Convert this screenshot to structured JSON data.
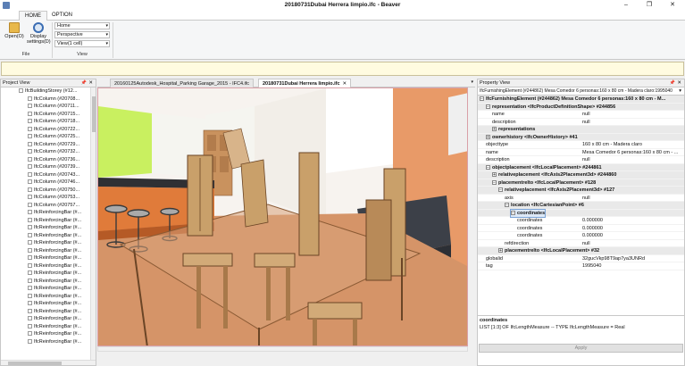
{
  "window": {
    "title": "20180731Dubai Herrera limpio.ifc - Beaver"
  },
  "ribbon": {
    "tabs": [
      "HOME",
      "OPTION"
    ],
    "open_label": "Open(O)",
    "display_label": "Display settings(D)",
    "combos": [
      "Home",
      "Perspective",
      "View(1 cell)"
    ],
    "group_file": "File",
    "group_view": "View"
  },
  "project_view": {
    "title": "Project View",
    "items": [
      "IfcBuildingStorey (#12...",
      "IfcColumn (#20708...",
      "IfcColumn (#20711...",
      "IfcColumn (#20715...",
      "IfcColumn (#20718...",
      "IfcColumn (#20722...",
      "IfcColumn (#20725...",
      "IfcColumn (#20729...",
      "IfcColumn (#20732...",
      "IfcColumn (#20736...",
      "IfcColumn (#20739...",
      "IfcColumn (#20743...",
      "IfcColumn (#20746...",
      "IfcColumn (#20750...",
      "IfcColumn (#20753...",
      "IfcColumn (#20757...",
      "IfcReinforcingBar (#...",
      "IfcReinforcingBar (#...",
      "IfcReinforcingBar (#...",
      "IfcReinforcingBar (#...",
      "IfcReinforcingBar (#...",
      "IfcReinforcingBar (#...",
      "IfcReinforcingBar (#...",
      "IfcReinforcingBar (#...",
      "IfcReinforcingBar (#...",
      "IfcReinforcingBar (#...",
      "IfcReinforcingBar (#...",
      "IfcReinforcingBar (#...",
      "IfcReinforcingBar (#...",
      "IfcReinforcingBar (#...",
      "IfcReinforcingBar (#...",
      "IfcReinforcingBar (#...",
      "IfcReinforcingBar (#...",
      "IfcReinforcingBar (#..."
    ]
  },
  "doc_tabs": [
    {
      "label": "20160125Autodesk_Hospital_Parking Garage_2015 - IFC4.ifc",
      "active": false
    },
    {
      "label": "20180731Dubai Herrera limpio.ifc",
      "active": true
    }
  ],
  "property_view": {
    "title": "Property View",
    "header": "IfcFurnishingElement (#244862) Mesa Comedor 6 personas:160 x 80 cm - Madera claro:1995040",
    "rows": [
      {
        "indent": 0,
        "type": "sect",
        "tog": "⊟",
        "key": "IfcFurnishingElement (#244862) Mesa Comedor 6 personas:160 x 80 cm - M...",
        "value": ""
      },
      {
        "indent": 1,
        "type": "sect",
        "tog": "⊟",
        "key": "representation <IfcProductDefinitionShape> #244856",
        "value": ""
      },
      {
        "indent": 2,
        "type": "row",
        "key": "name",
        "value": "null"
      },
      {
        "indent": 2,
        "type": "row",
        "key": "description",
        "value": "null"
      },
      {
        "indent": 2,
        "type": "sect",
        "tog": "⊞",
        "key": "representations",
        "value": ""
      },
      {
        "indent": 1,
        "type": "sect",
        "tog": "⊞",
        "key": "ownerhistory <IfcOwnerHistory> #41",
        "value": ""
      },
      {
        "indent": 1,
        "type": "row",
        "key": "objecttype",
        "value": "160 x 80 cm - Madera claro"
      },
      {
        "indent": 1,
        "type": "row",
        "key": "name",
        "value": "Mesa Comedor 6 personas:160 x 80 cm - ..."
      },
      {
        "indent": 1,
        "type": "row",
        "key": "description",
        "value": "null"
      },
      {
        "indent": 1,
        "type": "sect",
        "tog": "⊟",
        "key": "objectplacement <IfcLocalPlacement> #244861",
        "value": ""
      },
      {
        "indent": 2,
        "type": "sect",
        "tog": "⊞",
        "key": "relativeplacement <IfcAxis2Placement3d> #244860",
        "value": ""
      },
      {
        "indent": 2,
        "type": "sect",
        "tog": "⊟",
        "key": "placementrelto <IfcLocalPlacement> #128",
        "value": ""
      },
      {
        "indent": 3,
        "type": "sect",
        "tog": "⊟",
        "key": "relativeplacement <IfcAxis2Placement3d> #127",
        "value": ""
      },
      {
        "indent": 4,
        "type": "row",
        "key": "axis",
        "value": "null"
      },
      {
        "indent": 4,
        "type": "sect",
        "tog": "⊟",
        "key": "location <IfcCartesianPoint> #6",
        "value": ""
      },
      {
        "indent": 5,
        "type": "sect sel",
        "tog": "⊟",
        "key": "coordinates",
        "value": ""
      },
      {
        "indent": 6,
        "type": "row",
        "key": "coordinates",
        "value": "0.000000"
      },
      {
        "indent": 6,
        "type": "row",
        "key": "coordinates",
        "value": "0.000000"
      },
      {
        "indent": 6,
        "type": "row",
        "key": "coordinates",
        "value": "0.000000"
      },
      {
        "indent": 4,
        "type": "row",
        "key": "refdirection",
        "value": "null"
      },
      {
        "indent": 3,
        "type": "sect",
        "tog": "⊞",
        "key": "placementrelto <IfcLocalPlacement> #32",
        "value": ""
      },
      {
        "indent": 1,
        "type": "row",
        "key": "globalid",
        "value": "32gucVkp98T9ap7ya3UNRd"
      },
      {
        "indent": 1,
        "type": "row",
        "key": "tag",
        "value": "1995040"
      }
    ],
    "desc_title": "coordinates",
    "desc_text": "LIST [1:3] OF IfcLengthMeasure -- TYPE IfcLengthMeasure = Real",
    "apply_label": "Apply"
  },
  "colors": {
    "wall_orange": "#e89a68",
    "floor": "#c98a62",
    "wood": "#c9a06a",
    "lime": "#c9f060",
    "dark_counter": "#3c4048",
    "viewport_border": "#d9a0a8"
  }
}
